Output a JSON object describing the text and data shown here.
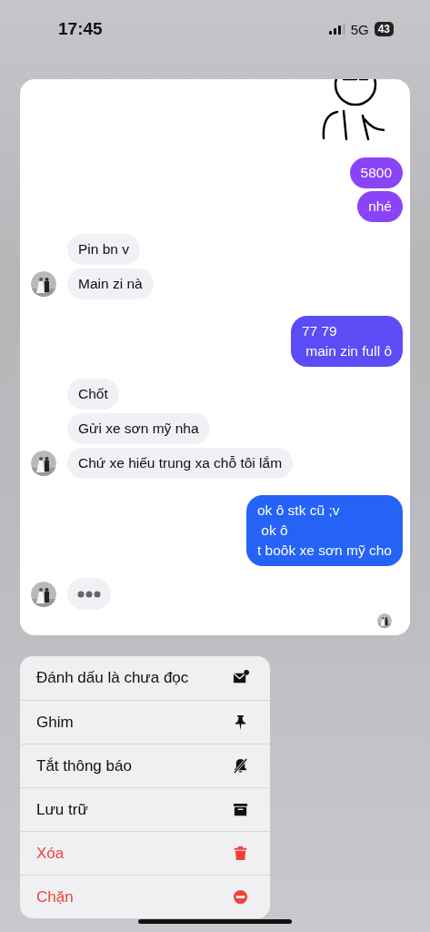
{
  "status_bar": {
    "time": "17:45",
    "network": "5G",
    "battery": "43"
  },
  "messages": [
    {
      "kind": "sticker"
    },
    {
      "kind": "outgoing",
      "color": "#8a44f7",
      "texts": [
        "5800",
        "nhé"
      ]
    },
    {
      "kind": "incoming",
      "texts": [
        "Pin bn v",
        "Main zi nà"
      ]
    },
    {
      "kind": "outgoing",
      "color": "#5b4cf6",
      "texts": [
        "77 79\n main zin full ô"
      ]
    },
    {
      "kind": "incoming",
      "texts": [
        "Chốt",
        "Gửi xe sơn mỹ nha",
        "Chứ xe hiếu trung xa chỗ tôi lắm"
      ]
    },
    {
      "kind": "outgoing",
      "color": "#2463f5",
      "texts": [
        "ok ô stk cũ ;v\n ok ô\nt boôk xe sơn mỹ cho"
      ]
    },
    {
      "kind": "typing"
    },
    {
      "kind": "seen"
    }
  ],
  "menu": [
    {
      "label": "Đánh dấu là chưa đọc",
      "kind": "unread",
      "danger": false
    },
    {
      "label": "Ghim",
      "kind": "pin",
      "danger": false
    },
    {
      "label": "Tắt thông báo",
      "kind": "mute",
      "danger": false
    },
    {
      "label": "Lưu trữ",
      "kind": "archive",
      "danger": false
    },
    {
      "label": "Xóa",
      "kind": "trash",
      "danger": true
    },
    {
      "label": "Chặn",
      "kind": "block",
      "danger": true
    }
  ]
}
